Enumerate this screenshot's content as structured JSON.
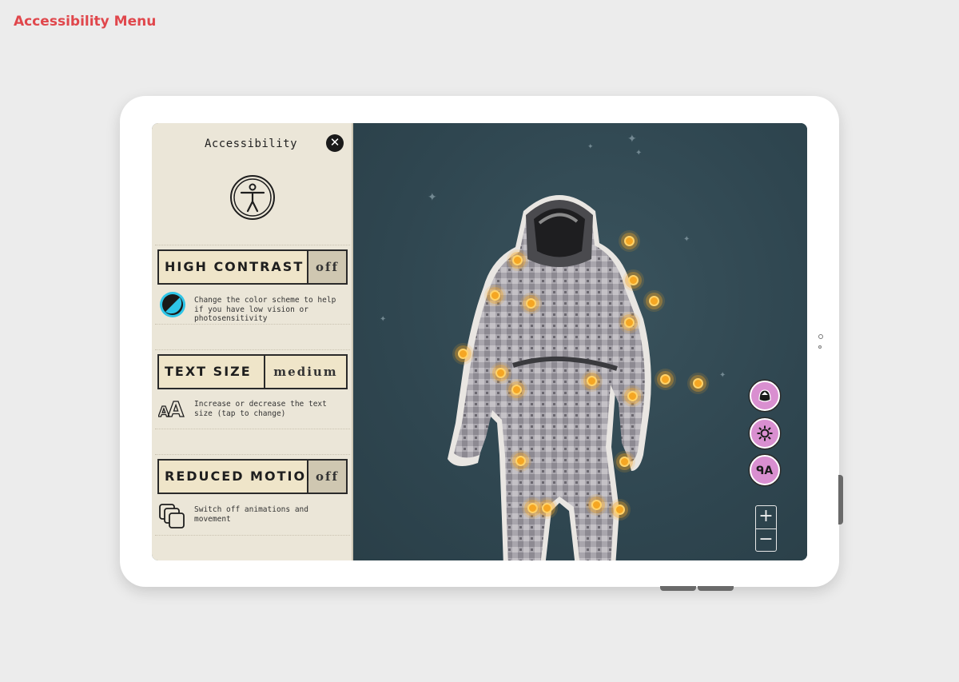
{
  "page": {
    "label": "Accessibility Menu"
  },
  "panel": {
    "title": "Accessibility",
    "close_icon": "close-icon",
    "accessibility_icon": "accessibility-person-icon"
  },
  "settings": {
    "high_contrast": {
      "label": "HIGH CONTRAST",
      "value": "off",
      "description": "Change the color scheme to help if you have low vision or photosensitivity",
      "icon": "contrast-icon"
    },
    "text_size": {
      "label": "TEXT SIZE",
      "value": "medium",
      "description": "Increase or decrease the text size (tap to change)",
      "icon": "text-size-icon"
    },
    "reduced_motion": {
      "label": "REDUCED MOTION",
      "value": "off",
      "description": "Switch off animations and movement",
      "icon": "layers-icon"
    }
  },
  "map_controls": {
    "buttons": [
      "helmet-icon",
      "settings-icon",
      "accessibility-text-icon"
    ],
    "zoom_in": "+",
    "zoom_out": "−"
  },
  "colors": {
    "accent_label": "#e0474c",
    "map_bg": "#2f4752",
    "panel_bg": "#ebe6d8",
    "hotspot": "#f5a623",
    "control_pink": "#d98fd0",
    "contrast_ring": "#2ec5e8"
  }
}
